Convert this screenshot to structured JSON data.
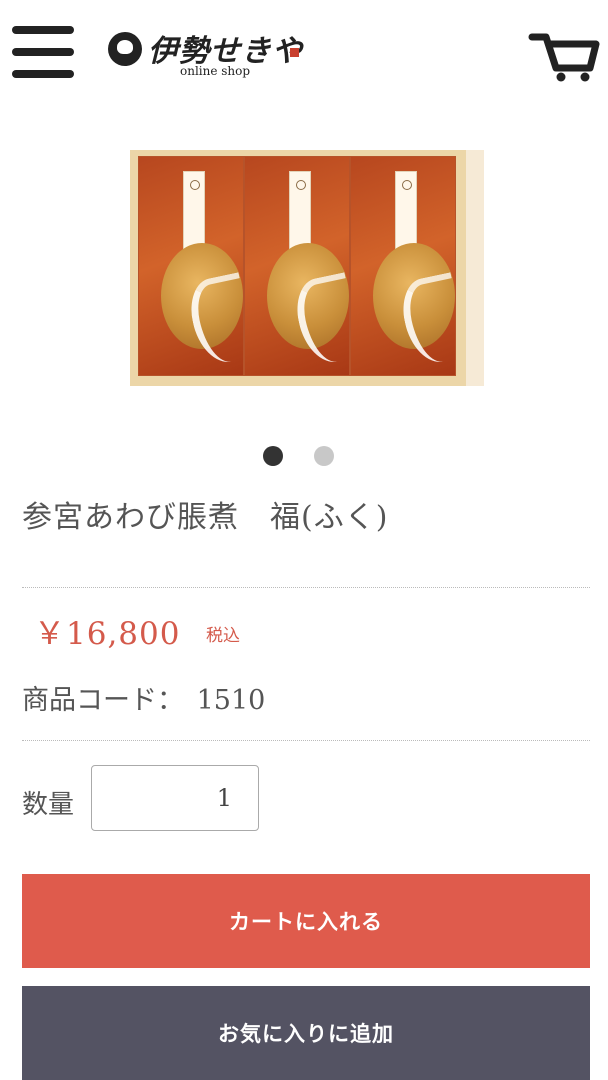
{
  "header": {
    "logo_text": "伊勢せきや",
    "logo_subtitle": "online shop",
    "menu_icon": "hamburger-menu-icon",
    "cart_icon": "shopping-cart-icon"
  },
  "gallery": {
    "slide_count": 2,
    "active_slide": 1,
    "dot_active_color": "#333333",
    "dot_inactive_color": "#c8c8c8"
  },
  "product": {
    "title": "参宮あわび脹煮　福(ふく)",
    "price": "￥16,800",
    "tax_label": "税込",
    "code_label": "商品コード：",
    "code_value": "1510",
    "quantity_label": "数量",
    "quantity_value": "1"
  },
  "actions": {
    "add_to_cart": "カートに入れる",
    "add_to_favorites": "お気に入りに追加"
  },
  "colors": {
    "price": "#d45a4b",
    "cart_button": "#df5b4c",
    "favorite_button": "#545363"
  }
}
